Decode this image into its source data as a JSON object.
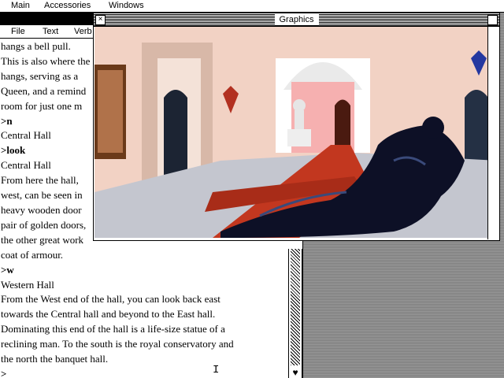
{
  "menubar": {
    "items": [
      "Main",
      "Accessories",
      "Windows"
    ]
  },
  "text_window": {
    "menu": [
      "File",
      "Text",
      "Verb"
    ],
    "transcript": [
      {
        "text": "hangs a bell pull.",
        "cmd": false
      },
      {
        "text": "This is also where the",
        "cmd": false
      },
      {
        "text": "hangs, serving as a",
        "cmd": false
      },
      {
        "text": "Queen, and a remind",
        "cmd": false
      },
      {
        "text": "room for just one m",
        "cmd": false
      },
      {
        "text": ">n",
        "cmd": true
      },
      {
        "text": "Central Hall",
        "cmd": false
      },
      {
        "text": ">look",
        "cmd": true
      },
      {
        "text": "Central Hall",
        "cmd": false
      },
      {
        "text": "From here the hall,",
        "cmd": false
      },
      {
        "text": "west, can be seen in",
        "cmd": false
      },
      {
        "text": "heavy wooden door",
        "cmd": false
      },
      {
        "text": "pair of golden doors,",
        "cmd": false
      },
      {
        "text": "the other great work",
        "cmd": false
      },
      {
        "text": "coat of armour.",
        "cmd": false
      },
      {
        "text": ">w",
        "cmd": true
      },
      {
        "text": "Western Hall",
        "cmd": false
      },
      {
        "text": "From the West end of the hall, you can look back east",
        "cmd": false
      },
      {
        "text": "towards the Central hall and beyond to the East hall.",
        "cmd": false
      },
      {
        "text": "Dominating this end of the hall is a life-size statue of a",
        "cmd": false
      },
      {
        "text": "reclining man. To the south is the royal conservatory and",
        "cmd": false
      },
      {
        "text": "the north the banquet hall.",
        "cmd": false
      },
      {
        "text": ">",
        "cmd": true
      }
    ]
  },
  "graphics_window": {
    "title": "Graphics"
  },
  "icons": {
    "close": "close-icon",
    "zoom": "zoom-box-icon",
    "scroll_arrow": "heart-icon",
    "cursor": "text-cursor-icon"
  },
  "colors": {
    "wall": "#f3cfc0",
    "carpet": "#c0361f",
    "statue": "#0d1026",
    "floor": "#c8c8d0"
  },
  "scrollbar_glyph": "♥",
  "cursor_glyph": "I"
}
